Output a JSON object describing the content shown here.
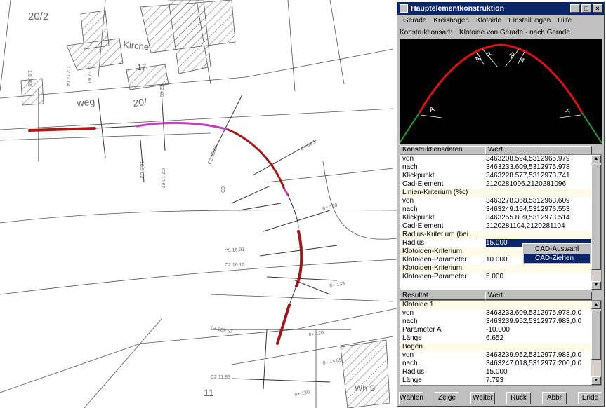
{
  "map": {
    "labels": {
      "parcel_top_left": "20/2",
      "church": "Kirche",
      "house_17": "17",
      "street": "weg",
      "street_num": "20/",
      "parcel_11": "11",
      "wws": "Wh S"
    }
  },
  "window": {
    "title": "Hauptelementkonstruktion",
    "buttons": {
      "minimize": "_",
      "maximize": "□",
      "close": "×"
    },
    "menu": [
      "Gerade",
      "Kreisbogen",
      "Klotoide",
      "Einstellungen",
      "Hilfe"
    ],
    "konstruktionsart_label": "Konstruktionsart:",
    "konstruktionsart_value": "Klotoide von Gerade - nach Gerade",
    "preview_labels": {
      "a": "A",
      "r": "R"
    },
    "data_table": {
      "headers": [
        "Konstruktionsdaten",
        "Wert"
      ],
      "rows": [
        {
          "k": "von",
          "v": "3463208.594,5312965.979"
        },
        {
          "k": "nach",
          "v": "3463233.609,5312975.978"
        },
        {
          "k": "Klickpunkt",
          "v": "3463228.577,5312973.741"
        },
        {
          "k": "Cad-Element",
          "v": "2120281096,2120281096"
        },
        {
          "k": "Linien-Kriterium (%c)",
          "v": ""
        },
        {
          "k": "von",
          "v": "3463278.368,5312963.609"
        },
        {
          "k": "nach",
          "v": "3463249.154,5312976.553"
        },
        {
          "k": "Klickpunkt",
          "v": "3463255.809,5312973.514"
        },
        {
          "k": "Cad-Element",
          "v": "2120281104,2120281104"
        },
        {
          "k": "Radius-Kriterium (bei ...",
          "v": ""
        },
        {
          "k": "Radius",
          "v": "15.000"
        },
        {
          "k": "Klotoiden-Kriterium",
          "v": ""
        },
        {
          "k": "Klotoiden-Parameter",
          "v": "10.000"
        },
        {
          "k": "Klotoiden-Kriterium",
          "v": ""
        },
        {
          "k": "Klotoiden-Parameter",
          "v": "5.000"
        }
      ]
    },
    "popup": [
      "CAD-Auswahl",
      "CAD-Ziehen"
    ],
    "result_table": {
      "headers": [
        "Resultat",
        "Wert"
      ],
      "rows": [
        {
          "k": "Klotoide 1",
          "v": ""
        },
        {
          "k": "von",
          "v": "3463233.609,5312975.978,0.0"
        },
        {
          "k": "nach",
          "v": "3463239.952,5312977.983,0.0"
        },
        {
          "k": "Parameter A",
          "v": "-10.000"
        },
        {
          "k": "Länge",
          "v": "6.652"
        },
        {
          "k": "Bogen",
          "v": ""
        },
        {
          "k": "von",
          "v": "3463239.952,5312977.983,0.0"
        },
        {
          "k": "nach",
          "v": "3463247.018,5312977.200,0.0"
        },
        {
          "k": "Radius",
          "v": "15.000"
        },
        {
          "k": "Länge",
          "v": "7.793"
        }
      ]
    },
    "bottom_buttons": [
      "Wählen",
      "Zeige",
      "Weiter",
      "Rück",
      "Abbr",
      "Ende"
    ]
  }
}
